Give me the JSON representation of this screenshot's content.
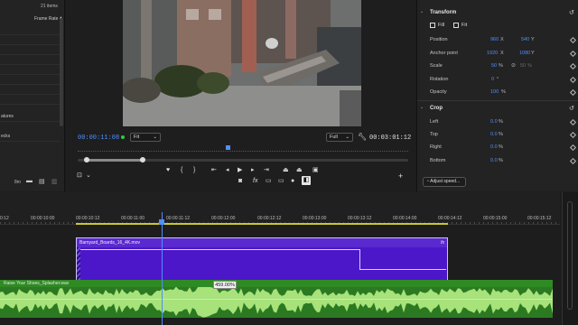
{
  "project_panel": {
    "item_count": "21 items",
    "column_header": "Frame Rate",
    "rows": [
      "atures",
      "ecks"
    ],
    "bottom_label": "8m"
  },
  "monitor": {
    "current_timecode": "00:00:11:08",
    "zoom_fit": "Fit",
    "resolution": "Full",
    "duration": "00:03:01:12"
  },
  "effect_controls": {
    "transform_label": "Transform",
    "fill_label": "Fill",
    "fit_label": "Fit",
    "position_label": "Position",
    "position_x": "960",
    "position_x_unit": "X",
    "position_y": "540",
    "position_y_unit": "Y",
    "anchor_label": "Anchor point",
    "anchor_x": "1920",
    "anchor_x_unit": "X",
    "anchor_y": "1080",
    "anchor_y_unit": "Y",
    "scale_label": "Scale",
    "scale_value": "50",
    "scale_unit": "%",
    "scale_width_value": "50",
    "scale_width_unit": "%",
    "rotation_label": "Rotation",
    "rotation_value": "0",
    "rotation_unit": "°",
    "opacity_label": "Opacity",
    "opacity_value": "100",
    "opacity_unit": "%",
    "crop_label": "Crop",
    "left_label": "Left",
    "left_value": "0.0",
    "left_unit": "%",
    "top_label": "Top",
    "top_value": "0.0",
    "top_unit": "%",
    "right_label": "Right",
    "right_value": "0.0",
    "right_unit": "%",
    "bottom_label": "Bottom",
    "bottom_value": "0.0",
    "bottom_unit": "%",
    "adjust_speed": "Adjust speed..."
  },
  "timeline": {
    "ruler_labels": [
      "0:12",
      "00:00:10:00",
      "00:00:10:12",
      "00:00:11:00",
      "00:00:11:12",
      "00:00:12:00",
      "00:00:12:12",
      "00:00:13:00",
      "00:00:13:12",
      "00:00:14:00",
      "00:00:14:12",
      "00:00:15:00",
      "00:00:15:12"
    ],
    "video_clip_name": "Barnyard_Boards_16_4K.mov",
    "video_clip_fx": "fx",
    "audio_clip_name": "Raise Your Shoes_Splasher.wav",
    "speed_badge": "459.00%"
  },
  "colors": {
    "accent": "#4f8fff",
    "video_clip": "#4b17c9",
    "audio_clip": "#2b7a22"
  }
}
